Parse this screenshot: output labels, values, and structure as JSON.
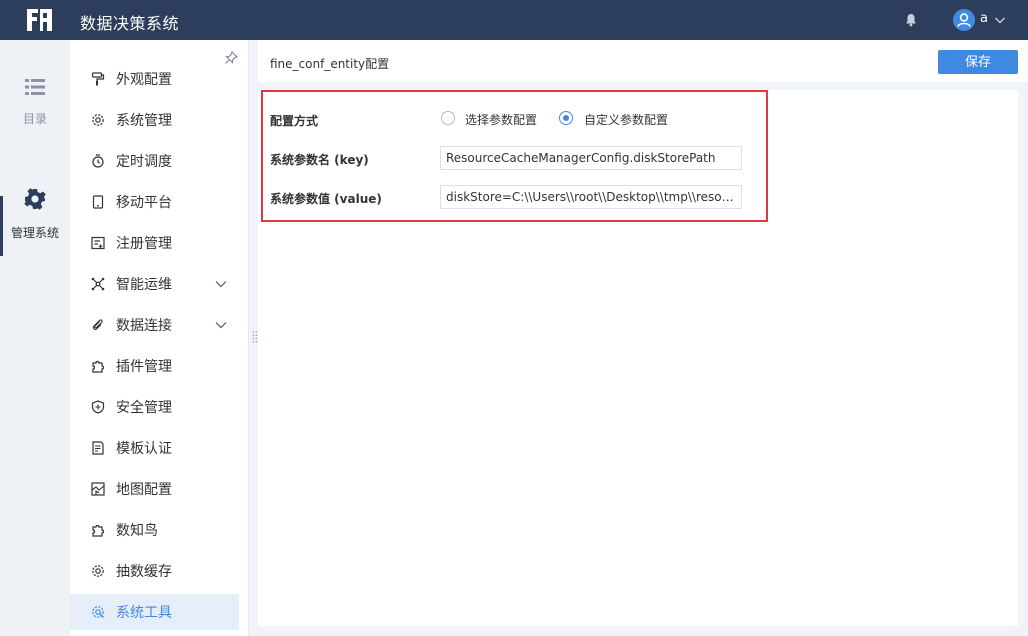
{
  "app": {
    "title": "数据决策系统"
  },
  "topbar": {
    "user_name": "a"
  },
  "rail": {
    "items": [
      {
        "label": "目录",
        "icon": "list-icon"
      },
      {
        "label": "管理系统",
        "icon": "gear-icon"
      }
    ]
  },
  "nav": {
    "items": [
      {
        "label": "外观配置",
        "icon": "paint-roller-icon"
      },
      {
        "label": "系统管理",
        "icon": "gear-icon"
      },
      {
        "label": "定时调度",
        "icon": "timer-icon"
      },
      {
        "label": "移动平台",
        "icon": "tablet-icon"
      },
      {
        "label": "注册管理",
        "icon": "register-icon"
      },
      {
        "label": "智能运维",
        "icon": "network-icon"
      },
      {
        "label": "数据连接",
        "icon": "link-icon"
      },
      {
        "label": "插件管理",
        "icon": "puzzle-icon"
      },
      {
        "label": "安全管理",
        "icon": "shield-icon"
      },
      {
        "label": "模板认证",
        "icon": "document-icon"
      },
      {
        "label": "地图配置",
        "icon": "map-icon"
      },
      {
        "label": "数知鸟",
        "icon": "puzzle-icon"
      },
      {
        "label": "抽数缓存",
        "icon": "gear-icon"
      },
      {
        "label": "系统工具",
        "icon": "gear-tool-icon"
      }
    ]
  },
  "content": {
    "entity_title": "fine_conf_entity配置",
    "save_label": "保存",
    "config_mode": {
      "label": "配置方式",
      "options": [
        "选择参数配置",
        "自定义参数配置"
      ],
      "selected": "自定义参数配置"
    },
    "param_key": {
      "label": "系统参数名 (key)",
      "value": "ResourceCacheManagerConfig.diskStorePath"
    },
    "param_value": {
      "label": "系统参数值 (value)",
      "value": "diskStore=C:\\\\Users\\\\root\\\\Desktop\\\\tmp\\\\resou..."
    }
  },
  "colors": {
    "topbar": "#2c3e5c",
    "accent": "#3f8ae0",
    "highlight_border": "#e0393e",
    "active_nav_bg": "#e6eef9"
  }
}
